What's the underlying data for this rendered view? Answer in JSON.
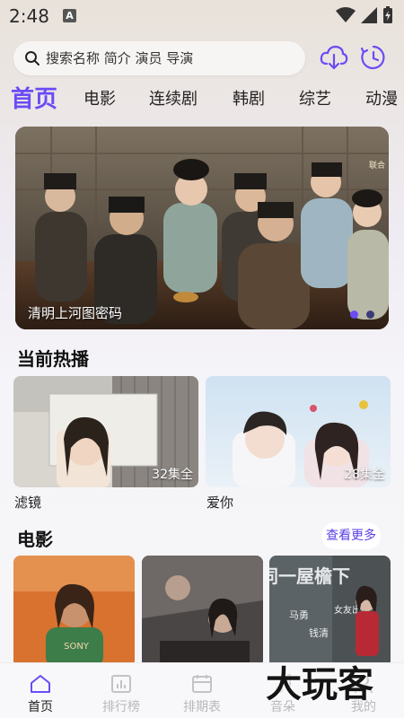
{
  "status_bar": {
    "time": "2:48",
    "notif_letter": "A"
  },
  "search": {
    "placeholder": "搜索名称 简介 演员 导演"
  },
  "categories": [
    {
      "label": "首页",
      "active": true
    },
    {
      "label": "电影"
    },
    {
      "label": "连续剧"
    },
    {
      "label": "韩剧"
    },
    {
      "label": "综艺"
    },
    {
      "label": "动漫"
    }
  ],
  "banner": {
    "caption": "清明上河图密码",
    "corner_text": "联合",
    "dots": 2,
    "active_dot": 0
  },
  "hot": {
    "title": "当前热播",
    "items": [
      {
        "title": "滤镜",
        "episodes": "32集全"
      },
      {
        "title": "爱你",
        "episodes": "28集全"
      }
    ]
  },
  "movies": {
    "title": "电影",
    "more_label": "查看更多",
    "poster_texts": [
      "SONY",
      "马勇",
      "钱清",
      "女友出门",
      "同一屋檐下"
    ]
  },
  "bottom_nav": [
    {
      "label": "首页",
      "icon": "home-icon",
      "active": true
    },
    {
      "label": "排行榜",
      "icon": "chart-icon"
    },
    {
      "label": "排期表",
      "icon": "calendar-icon"
    },
    {
      "label": "音朵",
      "icon": "music-icon"
    },
    {
      "label": "我的",
      "icon": "user-icon"
    }
  ],
  "watermark": "大玩客",
  "colors": {
    "accent": "#6a4cf5",
    "inactive_nav": "#b8b8bd"
  }
}
